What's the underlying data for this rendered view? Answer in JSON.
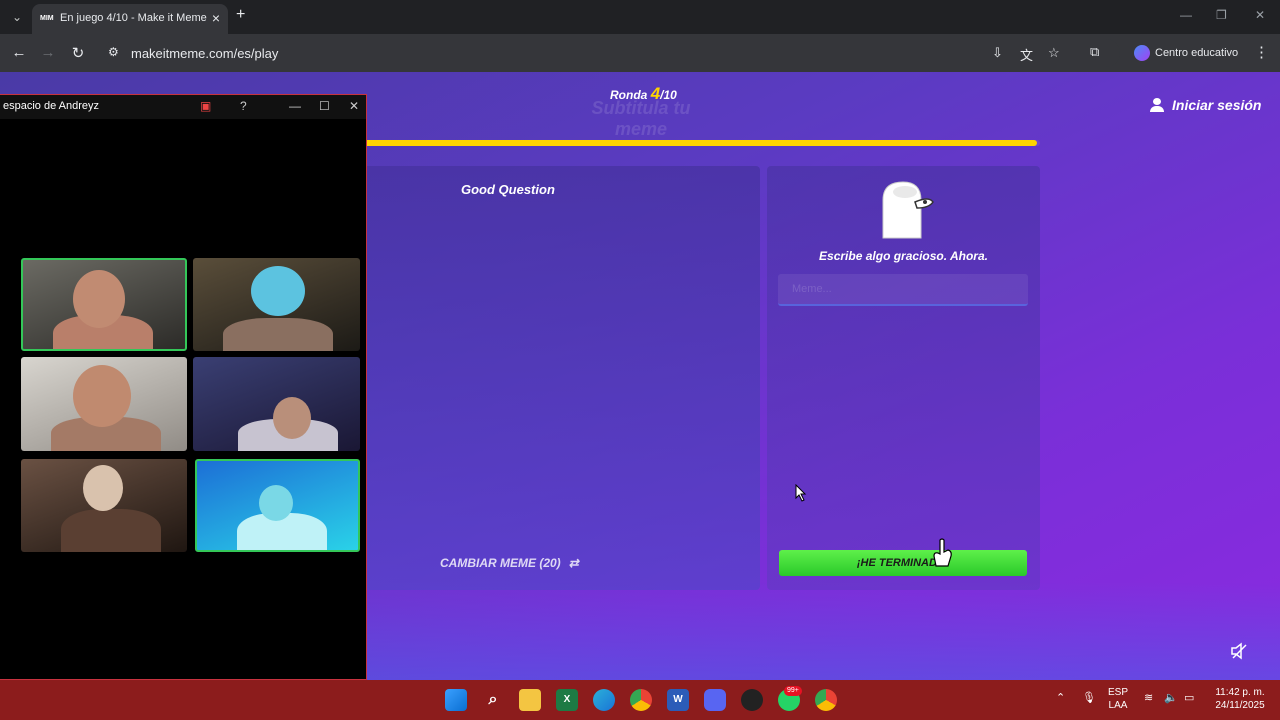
{
  "browser": {
    "tab_title": "En juego 4/10 - Make it Meme",
    "tab_favicon": "MIM",
    "url": "makeitmeme.com/es/play",
    "profile_label": "Centro educativo"
  },
  "game": {
    "round_label": "Ronda",
    "round_current": "4",
    "round_total": "/10",
    "subtitle": "Subtitula tu meme",
    "login_label": "Iniciar sesión",
    "progress_fraction": 0.996,
    "meme_title": "Good Question",
    "change_meme_label": "CAMBIAR MEME (20)",
    "prompt": "Escribe algo gracioso. Ahora.",
    "input_placeholder": "Meme...",
    "done_label": "¡HE TERMINADO!",
    "accent_yellow": "#ffd400",
    "done_green": "#34d434"
  },
  "call": {
    "title": "espacio de Andreyz"
  },
  "taskbar": {
    "lang_top": "ESP",
    "lang_bottom": "LAA",
    "time": "11:42 p. m.",
    "date": "24/11/2025",
    "badge": "99+"
  }
}
